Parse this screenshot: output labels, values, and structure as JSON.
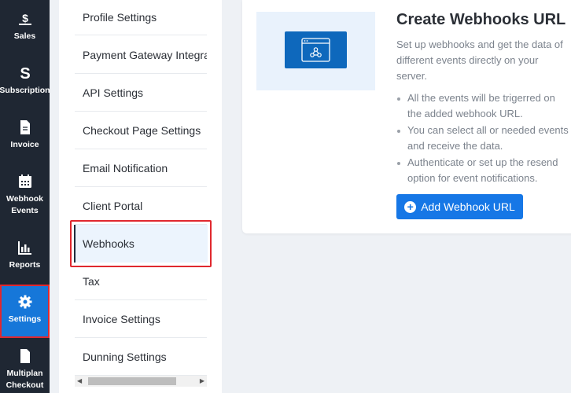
{
  "rail": {
    "items": [
      {
        "label": "Sales",
        "icon": "dollar-hand-icon"
      },
      {
        "label": "Subscription",
        "icon": "dollar-s-icon"
      },
      {
        "label": "Invoice",
        "icon": "document-icon"
      },
      {
        "label_line1": "Webhook",
        "label_line2": "Events",
        "icon": "calendar-icon"
      },
      {
        "label": "Reports",
        "icon": "bar-chart-icon"
      },
      {
        "label": "Settings",
        "icon": "gear-icon",
        "active": true
      },
      {
        "label_line1": "Multiplan",
        "label_line2": "Checkout",
        "icon": "document-icon"
      }
    ]
  },
  "settings_menu": {
    "items": [
      "Profile Settings",
      "Payment Gateway Integra",
      "API Settings",
      "Checkout Page Settings",
      "Email Notification",
      "Client Portal",
      "Webhooks",
      "Tax",
      "Invoice Settings",
      "Dunning Settings"
    ],
    "active_item": "Webhooks"
  },
  "webhooks": {
    "title": "Create Webhooks URL",
    "description": "Set up webhooks and get the data of different events directly on your server.",
    "bullets": [
      "All the events will be trigerred on the added webhook URL.",
      "You can select all or needed events and receive the data.",
      "Authenticate or set up the resend option for event notifications."
    ],
    "add_button": "Add Webhook URL"
  },
  "colors": {
    "rail_bg": "#1f2733",
    "accent": "#1677e6",
    "highlight_border": "#e0282e"
  }
}
